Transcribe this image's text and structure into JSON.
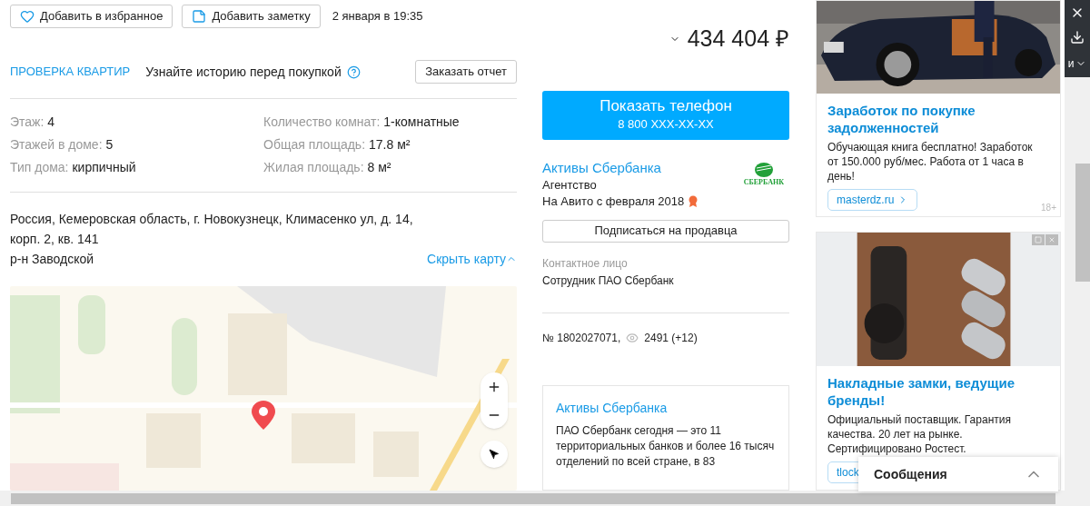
{
  "actions": [
    {
      "kind": "favorite",
      "label": "Добавить в избранное"
    },
    {
      "kind": "note",
      "label": "Добавить заметку"
    }
  ],
  "date": "2 января в 19:35",
  "price": "434 404 ₽",
  "check": {
    "label": "ПРОВЕРКА КВАРТИР",
    "text": "Узнайте историю перед покупкой",
    "button": "Заказать отчет"
  },
  "params": [
    {
      "label": "Этаж:",
      "value": "4"
    },
    {
      "label": "Количество комнат:",
      "value": "1-комнатные"
    },
    {
      "label": "Этажей в доме:",
      "value": "5"
    },
    {
      "label": "Общая площадь:",
      "value": "17.8 м²"
    },
    {
      "label": "Тип дома:",
      "value": "кирпичный"
    },
    {
      "label": "Жилая площадь:",
      "value": "8 м²"
    }
  ],
  "address": {
    "lines": [
      "Россия, Кемеровская область, г. Новокузнецк, Климасенко ул, д. 14,",
      "корп. 2, кв. 141"
    ],
    "district": "р-н Заводской",
    "map_toggle": "Скрыть карту"
  },
  "phone": {
    "label": "Показать телефон",
    "number": "8 800 XXX-XX-XX"
  },
  "seller": {
    "name": "Активы Сбербанка",
    "type": "Агентство",
    "since": "На Авито с февраля 2018",
    "logo_text": "СБЕРБАНК"
  },
  "subscribe": "Подписаться на продавца",
  "contact": {
    "label": "Контактное лицо",
    "name": "Сотрудник ПАО Сбербанк"
  },
  "ad_number": "№ 1802027071,",
  "views": "2491 (+12)",
  "about": {
    "title": "Активы Сбербанка",
    "text": "ПАО Сбербанк сегодня — это 11 территориальных банков и более 16 тысяч отделений по всей стране, в 83"
  },
  "ads": [
    {
      "kind": "car",
      "title": "Заработок по покупке задолженностей",
      "text": "Обучающая книга бесплатно! Заработок от 150.000 руб/мес. Работа от 1 часа в день!",
      "link": "masterdz.ru",
      "age": "18+"
    },
    {
      "kind": "lock",
      "title": "Накладные замки, ведущие бренды!",
      "text": "Официальный поставщик. Гарантия качества. 20 лет на рынке. Сертифицировано Ростест.",
      "link": "tlock"
    }
  ],
  "messages": "Сообщения",
  "overlay_text": "и"
}
